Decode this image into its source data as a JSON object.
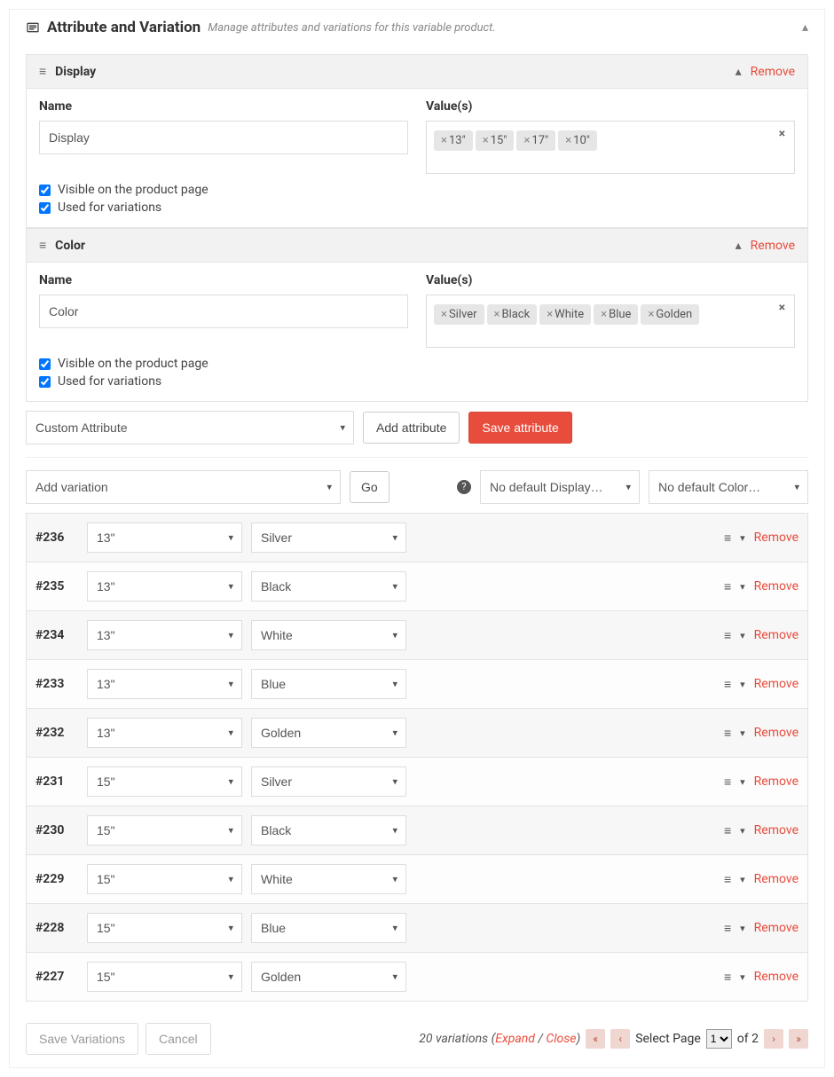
{
  "header": {
    "title": "Attribute and Variation",
    "subtitle": "Manage attributes and variations for this variable product."
  },
  "attributes": [
    {
      "title": "Display",
      "remove": "Remove",
      "name_label": "Name",
      "name_value": "Display",
      "values_label": "Value(s)",
      "values": [
        "13\"",
        "15\"",
        "17\"",
        "10\""
      ],
      "visible_label": "Visible on the product page",
      "used_label": "Used for variations"
    },
    {
      "title": "Color",
      "remove": "Remove",
      "name_label": "Name",
      "name_value": "Color",
      "values_label": "Value(s)",
      "values": [
        "Silver",
        "Black",
        "White",
        "Blue",
        "Golden"
      ],
      "visible_label": "Visible on the product page",
      "used_label": "Used for variations"
    }
  ],
  "attr_toolbar": {
    "custom_attribute": "Custom Attribute",
    "add_attribute": "Add attribute",
    "save_attribute": "Save attribute"
  },
  "var_toolbar": {
    "add_variation": "Add variation",
    "go": "Go",
    "default_display": "No default Display…",
    "default_color": "No default Color…"
  },
  "variations": [
    {
      "id": "#236",
      "display": "13\"",
      "color": "Silver",
      "remove": "Remove"
    },
    {
      "id": "#235",
      "display": "13\"",
      "color": "Black",
      "remove": "Remove"
    },
    {
      "id": "#234",
      "display": "13\"",
      "color": "White",
      "remove": "Remove"
    },
    {
      "id": "#233",
      "display": "13\"",
      "color": "Blue",
      "remove": "Remove"
    },
    {
      "id": "#232",
      "display": "13\"",
      "color": "Golden",
      "remove": "Remove"
    },
    {
      "id": "#231",
      "display": "15\"",
      "color": "Silver",
      "remove": "Remove"
    },
    {
      "id": "#230",
      "display": "15\"",
      "color": "Black",
      "remove": "Remove"
    },
    {
      "id": "#229",
      "display": "15\"",
      "color": "White",
      "remove": "Remove"
    },
    {
      "id": "#228",
      "display": "15\"",
      "color": "Blue",
      "remove": "Remove"
    },
    {
      "id": "#227",
      "display": "15\"",
      "color": "Golden",
      "remove": "Remove"
    }
  ],
  "footer": {
    "save_variations": "Save Variations",
    "cancel": "Cancel",
    "count_prefix": "20 variations (",
    "expand": "Expand",
    "slash": " / ",
    "close": "Close",
    "count_suffix": ")",
    "select_page": "Select Page",
    "page": "1",
    "of": "of 2"
  }
}
